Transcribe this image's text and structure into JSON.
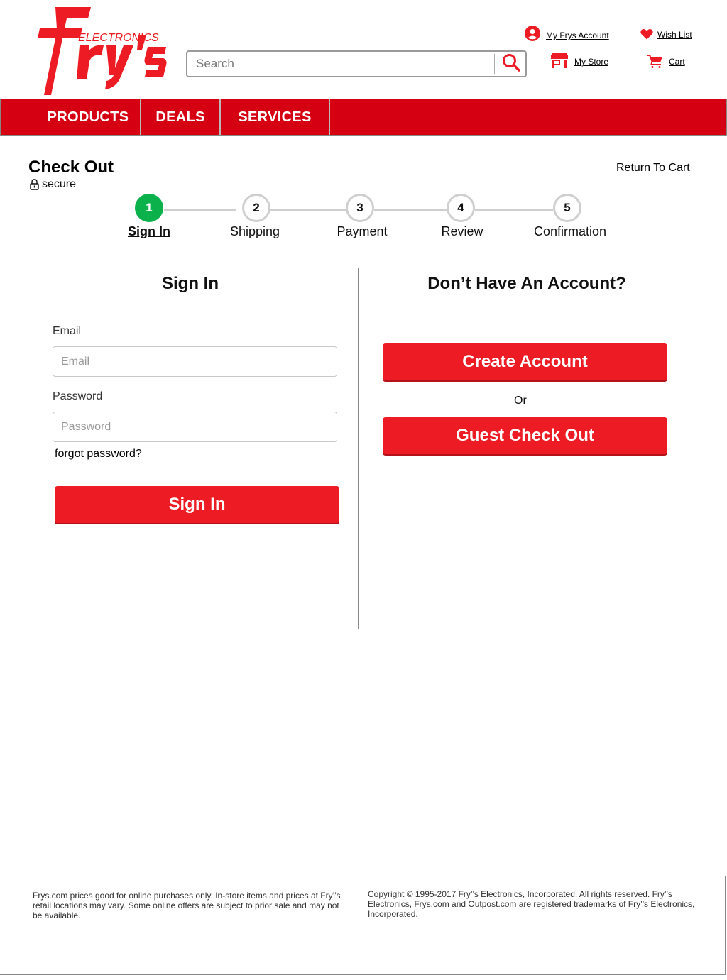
{
  "header": {
    "logo_text": "Fry's",
    "logo_subtext": "ELECTRONICS",
    "search_placeholder": "Search",
    "links": {
      "account": "My Frys Account",
      "wishlist": "Wish List",
      "store": "My Store",
      "cart": "Cart"
    }
  },
  "nav": {
    "items": [
      {
        "label": "PRODUCTS"
      },
      {
        "label": "DEALS"
      },
      {
        "label": "SERVICES"
      }
    ]
  },
  "checkout": {
    "title": "Check Out",
    "secure_label": "secure",
    "return_to_cart": "Return To Cart",
    "steps": [
      {
        "number": "1",
        "label": "Sign In",
        "active": true
      },
      {
        "number": "2",
        "label": "Shipping",
        "active": false
      },
      {
        "number": "3",
        "label": "Payment",
        "active": false
      },
      {
        "number": "4",
        "label": "Review",
        "active": false
      },
      {
        "number": "5",
        "label": "Confirmation",
        "active": false
      }
    ]
  },
  "signin": {
    "heading": "Sign In",
    "email_label": "Email",
    "email_placeholder": "Email",
    "email_value": "",
    "password_label": "Password",
    "password_placeholder": "Password",
    "password_value": "",
    "forgot_password": "forgot password?",
    "button_label": "Sign In"
  },
  "no_account": {
    "heading": "Don’t Have An Account?",
    "create_account": "Create Account",
    "or_text": "Or",
    "guest_checkout": "Guest Check Out"
  },
  "footer": {
    "left_text": "Frys.com prices good for online purchases only. In-store items and prices at Fry’’s retail locations may vary. Some online offers are subject to prior sale and may not be available.",
    "right_text": "Copyright © 1995-2017 Fry’’s Electronics, Incorporated. All rights reserved. Fry’’s Electronics, Frys.com and Outpost.com are registered trademarks of Fry’’s Electronics, Incorporated."
  },
  "colors": {
    "brand_red": "#ed1c24",
    "nav_red": "#d50011",
    "step_active_green": "#0bb14b"
  },
  "icons": {
    "account": "account-circle-icon",
    "wishlist": "heart-icon",
    "store": "store-icon",
    "cart": "cart-icon",
    "search": "search-icon",
    "secure": "lock-icon"
  }
}
